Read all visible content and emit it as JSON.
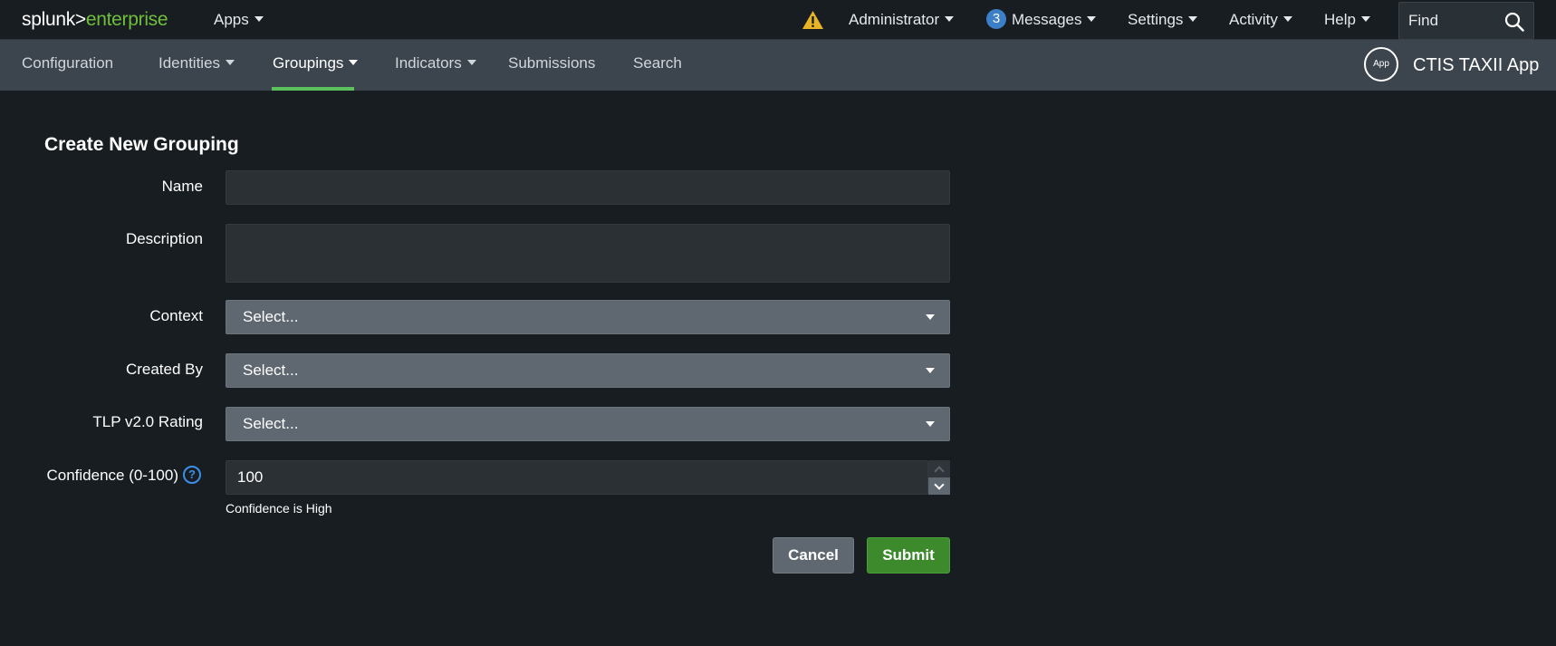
{
  "topbar": {
    "logo_part1": "splunk>",
    "logo_part2": "enterprise",
    "apps_label": "Apps",
    "user_label": "Administrator",
    "messages_count": "3",
    "messages_label": "Messages",
    "settings_label": "Settings",
    "activity_label": "Activity",
    "help_label": "Help",
    "find_placeholder": "Find"
  },
  "appnav": {
    "items": [
      {
        "label": "Configuration"
      },
      {
        "label": "Identities"
      },
      {
        "label": "Groupings"
      },
      {
        "label": "Indicators"
      },
      {
        "label": "Submissions"
      },
      {
        "label": "Search"
      }
    ],
    "active_item": "Groupings",
    "app_badge": "App",
    "app_name": "CTIS TAXII App"
  },
  "form": {
    "title": "Create New Grouping",
    "name_label": "Name",
    "name_value": "",
    "description_label": "Description",
    "description_value": "",
    "context_label": "Context",
    "context_value": "Select...",
    "created_by_label": "Created By",
    "created_by_value": "Select...",
    "tlp_label": "TLP v2.0 Rating",
    "tlp_value": "Select...",
    "confidence_label": "Confidence (0-100)",
    "confidence_help_glyph": "?",
    "confidence_value": "100",
    "confidence_help_text": "Confidence is High",
    "cancel_label": "Cancel",
    "submit_label": "Submit"
  },
  "colors": {
    "accent_green": "#5cc05c",
    "submit_green": "#3d8a2d",
    "warning_yellow": "#e8b325",
    "message_blue": "#3c7fc9"
  }
}
